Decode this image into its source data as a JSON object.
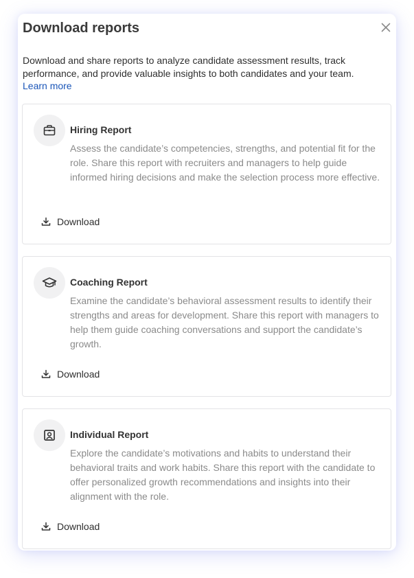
{
  "dialog": {
    "title": "Download reports",
    "intro": "Download and share reports to analyze candidate assessment results, track performance, and provide valuable insights to both candidates and your team.",
    "learn_more": "Learn more"
  },
  "reports": [
    {
      "icon": "briefcase-icon",
      "title": "Hiring Report",
      "description": "Assess the candidate’s competencies, strengths, and potential fit for the role. Share this report with recruiters and managers to help guide informed hiring decisions and make the selection process more effective.",
      "download_label": "Download"
    },
    {
      "icon": "graduation-cap-icon",
      "title": "Coaching Report",
      "description": "Examine the candidate’s behavioral assessment results to identify their strengths and areas for development. Share this report with managers to help them guide coaching conversations and support the candidate’s growth.",
      "download_label": "Download"
    },
    {
      "icon": "person-badge-icon",
      "title": "Individual Report",
      "description": "Explore the candidate’s motivations and habits to understand their behavioral traits and work habits. Share this report with the candidate to offer personalized growth recommendations and insights into their alignment with the role.",
      "download_label": "Download"
    }
  ]
}
